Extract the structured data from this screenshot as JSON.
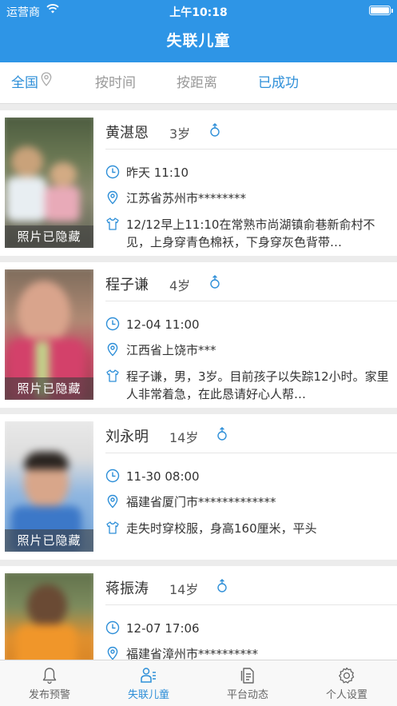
{
  "status": {
    "carrier": "运营商",
    "time": "上午10:18"
  },
  "nav": {
    "title": "失联儿童"
  },
  "filters": [
    {
      "label": "全国"
    },
    {
      "label": "按时间"
    },
    {
      "label": "按距离"
    },
    {
      "label": "已成功"
    }
  ],
  "photo_hidden_label": "照片已隐藏",
  "children": [
    {
      "name": "黄湛恩",
      "age": "3岁",
      "gender": "male",
      "time": "昨天 11:10",
      "location": "江苏省苏州市********",
      "description": "12/12早上11:10在常熟市尚湖镇俞巷新俞村不见，上身穿青色棉袄，下身穿灰色背带…"
    },
    {
      "name": "程子谦",
      "age": "4岁",
      "gender": "male",
      "time": "12-04 11:00",
      "location": "江西省上饶市***",
      "description": "程子谦，男，3岁。目前孩子以失踪12小时。家里人非常着急，在此恳请好心人帮…"
    },
    {
      "name": "刘永明",
      "age": "14岁",
      "gender": "male",
      "time": "11-30 08:00",
      "location": "福建省厦门市*************",
      "description": "走失时穿校服，身高160厘米，平头"
    },
    {
      "name": "蒋振涛",
      "age": "14岁",
      "gender": "male",
      "time": "12-07 17:06",
      "location": "福建省漳州市**********",
      "description": ""
    }
  ],
  "tabs": [
    {
      "label": "发布预警",
      "icon": "bell-icon"
    },
    {
      "label": "失联儿童",
      "icon": "children-icon"
    },
    {
      "label": "平台动态",
      "icon": "document-icon"
    },
    {
      "label": "个人设置",
      "icon": "gear-icon"
    }
  ],
  "colors": {
    "primary": "#2e95e6",
    "accent_text": "#2e8fd8",
    "background": "#ececec"
  }
}
